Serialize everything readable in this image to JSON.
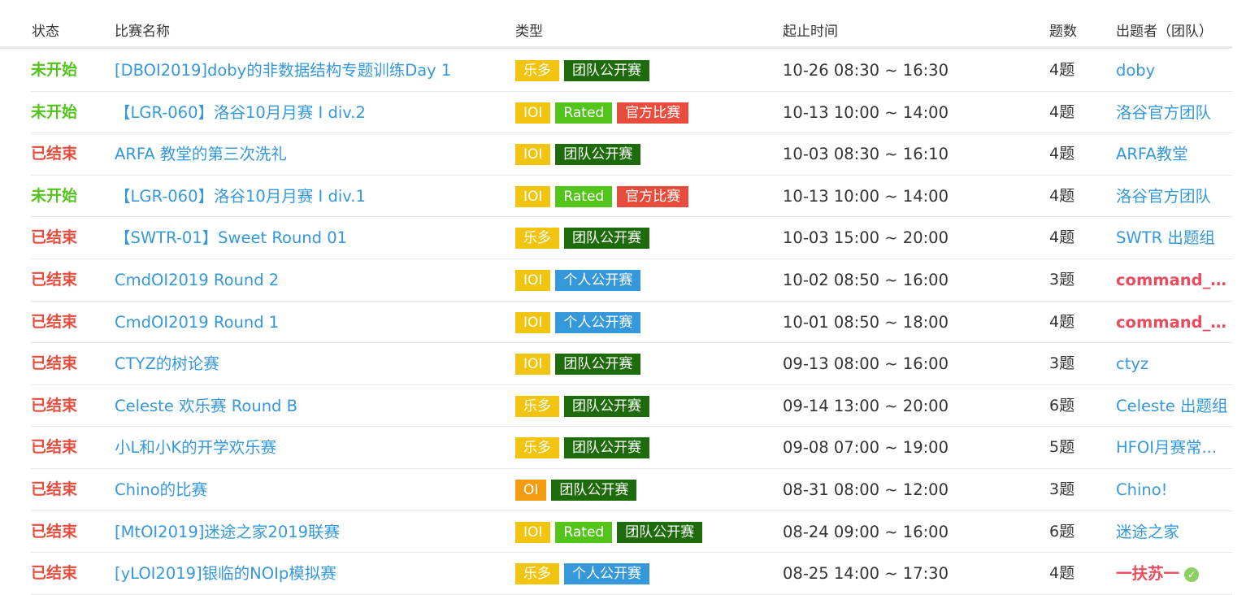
{
  "header": {
    "status": "状态",
    "name": "比赛名称",
    "type": "类型",
    "time": "起止时间",
    "count": "题数",
    "host": "出题者（团队）"
  },
  "colors": {
    "lemon": "#f1c40f",
    "ioi": "#f1c40f",
    "oi": "#f39c12",
    "rated": "#52c41a",
    "official": "#e74c3c",
    "team": "#1e6b0c",
    "personal": "#3498db"
  },
  "rows": [
    {
      "status": "未开始",
      "kind": "upcoming",
      "name": "[DBOI2019]doby的非数据结构专题训练Day 1",
      "tags": [
        {
          "label": "乐多",
          "color": "#f1c40f"
        },
        {
          "label": "团队公开赛",
          "color": "#1e6b0c"
        }
      ],
      "time": "10-26 08:30 ~ 16:30",
      "count": "4题",
      "host": "doby",
      "hostStyle": "blue"
    },
    {
      "status": "未开始",
      "kind": "upcoming",
      "name": "【LGR-060】洛谷10月月赛 I div.2",
      "tags": [
        {
          "label": "IOI",
          "color": "#f1c40f"
        },
        {
          "label": "Rated",
          "color": "#52c41a"
        },
        {
          "label": "官方比赛",
          "color": "#e74c3c"
        }
      ],
      "time": "10-13 10:00 ~ 14:00",
      "count": "4题",
      "host": "洛谷官方团队",
      "hostStyle": "blue"
    },
    {
      "status": "已结束",
      "kind": "ended",
      "name": "ARFA 教堂的第三次洗礼",
      "tags": [
        {
          "label": "IOI",
          "color": "#f1c40f"
        },
        {
          "label": "团队公开赛",
          "color": "#1e6b0c"
        }
      ],
      "time": "10-03 08:30 ~ 16:10",
      "count": "4题",
      "host": "ARFA教堂",
      "hostStyle": "blue"
    },
    {
      "status": "未开始",
      "kind": "upcoming",
      "name": "【LGR-060】洛谷10月月赛 I div.1",
      "tags": [
        {
          "label": "IOI",
          "color": "#f1c40f"
        },
        {
          "label": "Rated",
          "color": "#52c41a"
        },
        {
          "label": "官方比赛",
          "color": "#e74c3c"
        }
      ],
      "time": "10-13 10:00 ~ 14:00",
      "count": "4题",
      "host": "洛谷官方团队",
      "hostStyle": "blue"
    },
    {
      "status": "已结束",
      "kind": "ended",
      "name": "【SWTR-01】Sweet Round 01",
      "tags": [
        {
          "label": "乐多",
          "color": "#f1c40f"
        },
        {
          "label": "团队公开赛",
          "color": "#1e6b0c"
        }
      ],
      "time": "10-03 15:00 ~ 20:00",
      "count": "4题",
      "host": "SWTR 出题组",
      "hostStyle": "blue"
    },
    {
      "status": "已结束",
      "kind": "ended",
      "name": "CmdOI2019 Round 2",
      "tags": [
        {
          "label": "IOI",
          "color": "#f1c40f"
        },
        {
          "label": "个人公开赛",
          "color": "#3498db"
        }
      ],
      "time": "10-02 08:50 ~ 16:00",
      "count": "3题",
      "host": "command_b...",
      "hostStyle": "red"
    },
    {
      "status": "已结束",
      "kind": "ended",
      "name": "CmdOI2019 Round 1",
      "tags": [
        {
          "label": "IOI",
          "color": "#f1c40f"
        },
        {
          "label": "个人公开赛",
          "color": "#3498db"
        }
      ],
      "time": "10-01 08:50 ~ 18:00",
      "count": "4题",
      "host": "command_b...",
      "hostStyle": "red"
    },
    {
      "status": "已结束",
      "kind": "ended",
      "name": "CTYZ的树论赛",
      "tags": [
        {
          "label": "IOI",
          "color": "#f1c40f"
        },
        {
          "label": "团队公开赛",
          "color": "#1e6b0c"
        }
      ],
      "time": "09-13 08:00 ~ 16:00",
      "count": "3题",
      "host": "ctyz",
      "hostStyle": "blue"
    },
    {
      "status": "已结束",
      "kind": "ended",
      "name": "Celeste 欢乐赛 Round B",
      "tags": [
        {
          "label": "乐多",
          "color": "#f1c40f"
        },
        {
          "label": "团队公开赛",
          "color": "#1e6b0c"
        }
      ],
      "time": "09-14 13:00 ~ 20:00",
      "count": "6题",
      "host": "Celeste 出题组",
      "hostStyle": "blue"
    },
    {
      "status": "已结束",
      "kind": "ended",
      "name": "小L和小K的开学欢乐赛",
      "tags": [
        {
          "label": "乐多",
          "color": "#f1c40f"
        },
        {
          "label": "团队公开赛",
          "color": "#1e6b0c"
        }
      ],
      "time": "09-08 07:00 ~ 19:00",
      "count": "5题",
      "host": "HFOI月赛常...",
      "hostStyle": "blue"
    },
    {
      "status": "已结束",
      "kind": "ended",
      "name": "Chino的比赛",
      "tags": [
        {
          "label": "OI",
          "color": "#f39c12"
        },
        {
          "label": "团队公开赛",
          "color": "#1e6b0c"
        }
      ],
      "time": "08-31 08:00 ~ 12:00",
      "count": "3题",
      "host": "Chino!",
      "hostStyle": "blue"
    },
    {
      "status": "已结束",
      "kind": "ended",
      "name": "[MtOI2019]迷途之家2019联赛",
      "tags": [
        {
          "label": "IOI",
          "color": "#f1c40f"
        },
        {
          "label": "Rated",
          "color": "#52c41a"
        },
        {
          "label": "团队公开赛",
          "color": "#1e6b0c"
        }
      ],
      "time": "08-24 09:00 ~ 16:00",
      "count": "6题",
      "host": "迷途之家",
      "hostStyle": "blue"
    },
    {
      "status": "已结束",
      "kind": "ended",
      "name": "[yLOI2019]银临的NOIp模拟赛",
      "tags": [
        {
          "label": "乐多",
          "color": "#f1c40f"
        },
        {
          "label": "个人公开赛",
          "color": "#3498db"
        }
      ],
      "time": "08-25 14:00 ~ 17:30",
      "count": "4题",
      "host": "一扶苏一",
      "hostStyle": "red",
      "verified": true
    }
  ]
}
